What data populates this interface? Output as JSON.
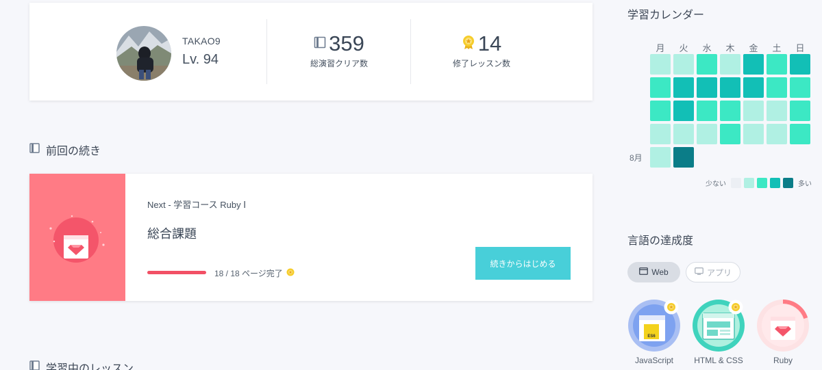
{
  "profile": {
    "username": "TAKAO9",
    "level": "Lv. 94",
    "stats": [
      {
        "value": "359",
        "label": "総演習クリア数",
        "icon": "notebook-icon"
      },
      {
        "value": "14",
        "label": "修了レッスン数",
        "icon": "medal-icon"
      }
    ]
  },
  "continue_section": {
    "title": "前回の続き",
    "next_label": "Next - 学習コース Ruby Ⅰ",
    "lesson_title": "総合課題",
    "progress_text": "18 / 18 ページ完了",
    "progress_fraction": 1.0,
    "resume_button": "続きからはじめる"
  },
  "learning_section": {
    "title": "学習中のレッスン"
  },
  "calendar": {
    "title": "学習カレンダー",
    "weekdays": [
      "月",
      "火",
      "水",
      "木",
      "金",
      "土",
      "日"
    ],
    "month_label": "8月",
    "levels": [
      [
        1,
        1,
        2,
        1,
        3,
        2,
        3
      ],
      [
        2,
        3,
        3,
        3,
        3,
        2,
        2
      ],
      [
        2,
        3,
        2,
        2,
        1,
        1,
        2
      ],
      [
        1,
        1,
        1,
        2,
        1,
        1,
        2
      ],
      [
        1,
        4,
        null,
        null,
        null,
        null,
        null
      ]
    ],
    "level_colors": [
      "#eceff4",
      "#b0f0e3",
      "#3ce8c4",
      "#12bfb6",
      "#0b7d88"
    ],
    "legend_less": "少ない",
    "legend_more": "多い"
  },
  "languages_section": {
    "title": "言語の達成度",
    "tabs": [
      {
        "label": "Web",
        "selected": true,
        "icon": "browser-icon"
      },
      {
        "label": "アプリ",
        "selected": false,
        "icon": "monitor-icon"
      }
    ],
    "items": [
      {
        "label": "JavaScript",
        "completion": 1.0,
        "color": "#a9bff3",
        "medal": true
      },
      {
        "label": "HTML & CSS",
        "completion": 1.0,
        "color": "#3fd3bd",
        "medal": true
      },
      {
        "label": "Ruby",
        "completion": 0.2,
        "color": "#ff7b85",
        "medal": false
      }
    ]
  }
}
